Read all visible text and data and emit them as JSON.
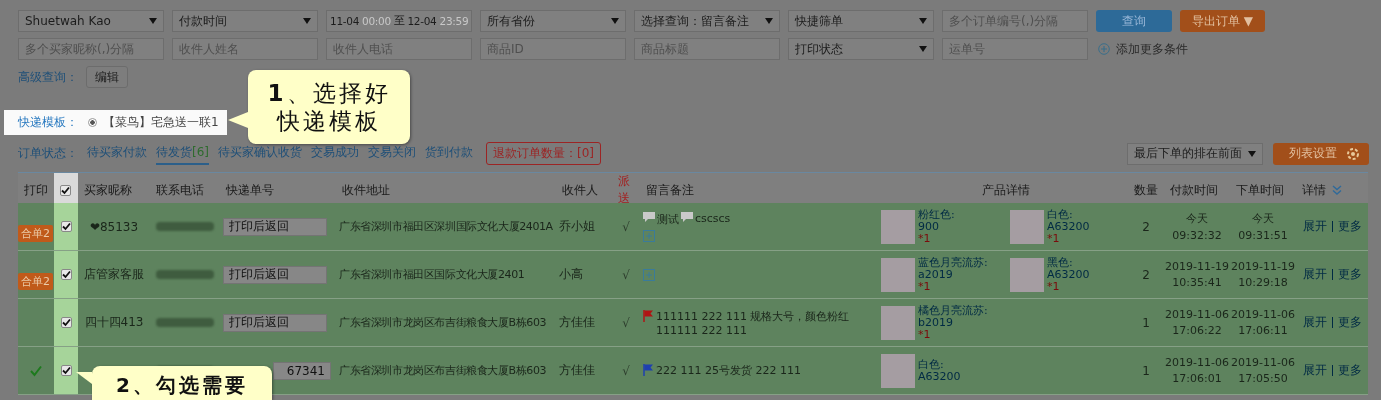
{
  "filters": {
    "rows": [
      [
        {
          "kind": "select",
          "value": "Shuetwah Kao"
        },
        {
          "kind": "select",
          "value": "付款时间"
        },
        {
          "kind": "daterange",
          "parts": [
            {
              "text": "11-04",
              "dim": false
            },
            {
              "text": "00:00",
              "dim": true
            },
            {
              "text": "至",
              "dim": false
            },
            {
              "text": "12-04",
              "dim": false
            },
            {
              "text": "23:59",
              "dim": true
            }
          ]
        },
        {
          "kind": "select",
          "value": "所有省份"
        },
        {
          "kind": "select",
          "value": "选择查询：留言备注"
        },
        {
          "kind": "select",
          "value": "快捷筛单"
        },
        {
          "kind": "input",
          "placeholder": "多个订单编号(,)分隔"
        },
        {
          "kind": "primary",
          "label": "查询"
        },
        {
          "kind": "export",
          "label": "导出订单 ▼"
        }
      ],
      [
        {
          "kind": "input",
          "placeholder": "多个买家昵称(,)分隔"
        },
        {
          "kind": "input",
          "placeholder": "收件人姓名"
        },
        {
          "kind": "input",
          "placeholder": "收件人电话"
        },
        {
          "kind": "input",
          "placeholder": "商品ID"
        },
        {
          "kind": "input",
          "placeholder": "商品标题"
        },
        {
          "kind": "select",
          "value": "打印状态"
        },
        {
          "kind": "input",
          "placeholder": "运单号"
        },
        {
          "kind": "add",
          "label": "添加更多条件"
        }
      ]
    ]
  },
  "advanced": {
    "label": "高级查询：",
    "button": "编辑"
  },
  "template": {
    "label": "快递模板：",
    "options": [
      {
        "label": "【菜鸟】宅急送一联1",
        "selected": true
      }
    ]
  },
  "status_bar": {
    "label": "订单状态：",
    "tabs": [
      {
        "label": "待买家付款",
        "selected": false
      },
      {
        "label": "待发货",
        "count": "[6]",
        "selected": true
      },
      {
        "label": "待买家确认收货",
        "selected": false
      },
      {
        "label": "交易成功",
        "selected": false
      },
      {
        "label": "交易关闭",
        "selected": false
      },
      {
        "label": "货到付款",
        "selected": false
      }
    ],
    "refund": "退款订单数量：[0]",
    "sort": "最后下单的排在前面",
    "settings_button": "列表设置"
  },
  "table": {
    "columns": [
      {
        "kind": "text",
        "label": "打印"
      },
      {
        "kind": "checkbox",
        "checked": true
      },
      {
        "kind": "text",
        "label": "买家昵称"
      },
      {
        "kind": "text",
        "label": "联系电话"
      },
      {
        "kind": "text",
        "label": "快递单号"
      },
      {
        "kind": "text",
        "label": "收件地址"
      },
      {
        "kind": "text",
        "label": "收件人"
      },
      {
        "kind": "accent",
        "label": "派送"
      },
      {
        "kind": "text",
        "label": "留言备注"
      },
      {
        "kind": "text",
        "label": "产品详情"
      },
      {
        "kind": "text",
        "label": "数量"
      },
      {
        "kind": "text",
        "label": "付款时间"
      },
      {
        "kind": "text",
        "label": "下单时间"
      },
      {
        "kind": "expand",
        "label": "详情"
      }
    ],
    "rows": [
      {
        "printed": false,
        "merge_badge": "合单2",
        "checked": true,
        "nickname": "❤85133",
        "tracking": "打印后返回",
        "address": "广东省深圳市福田区深圳国际文化大厦2401A",
        "receiver": "乔小姐",
        "dispatch": "√",
        "notes": [
          {
            "kind": "message",
            "text": "测试"
          },
          {
            "kind": "message",
            "text": "cscscs"
          },
          {
            "kind": "add"
          }
        ],
        "products": [
          {
            "name": "粉红色:",
            "code": "900",
            "qty": "*1"
          },
          {
            "name": "白色:",
            "code": "A63200",
            "qty": "*1"
          }
        ],
        "quantity": "2",
        "paid": [
          "今天",
          "09:32:32"
        ],
        "ordered": [
          "今天",
          "09:31:51"
        ],
        "actions": [
          "展开",
          "更多"
        ]
      },
      {
        "printed": false,
        "merge_badge": "合单2",
        "checked": true,
        "nickname": "店管家客服",
        "tracking": "打印后返回",
        "address": "广东省深圳市福田区国际文化大厦2401",
        "receiver": "小高",
        "dispatch": "√",
        "notes": [
          {
            "kind": "add"
          }
        ],
        "products": [
          {
            "name": "蓝色月亮流苏:",
            "code": "a2019",
            "qty": "*1"
          },
          {
            "name": "黑色:",
            "code": "A63200",
            "qty": "*1"
          }
        ],
        "quantity": "2",
        "paid": [
          "2019-11-19",
          "10:35:41"
        ],
        "ordered": [
          "2019-11-19",
          "10:29:18"
        ],
        "actions": [
          "展开",
          "更多"
        ]
      },
      {
        "printed": false,
        "checked": true,
        "nickname": "四十四413",
        "tracking": "打印后返回",
        "address": "广东省深圳市龙岗区布吉街粮食大厦B栋603",
        "receiver": "方佳佳",
        "dispatch": "√",
        "notes": [
          {
            "kind": "flag",
            "color": "#b01414",
            "text": "111111 222 111 规格大号，颜色粉红 111111 222 111"
          }
        ],
        "products": [
          {
            "name": "橘色月亮流苏:",
            "code": "b2019",
            "qty": "*1"
          }
        ],
        "quantity": "1",
        "paid": [
          "2019-11-06",
          "17:06:22"
        ],
        "ordered": [
          "2019-11-06",
          "17:06:11"
        ],
        "actions": [
          "展开",
          "更多"
        ]
      },
      {
        "printed": true,
        "checked": true,
        "tracking": "67341",
        "address": "广东省深圳市龙岗区布吉街粮食大厦B栋603",
        "receiver": "方佳佳",
        "dispatch": "√",
        "notes": [
          {
            "kind": "flag",
            "color": "#1f3fb0",
            "text": "222 111 25号发货 222 111"
          }
        ],
        "products": [
          {
            "name": "白色:",
            "code": "A63200"
          }
        ],
        "quantity": "1",
        "paid": [
          "2019-11-06",
          "17:06:01"
        ],
        "ordered": [
          "2019-11-06",
          "17:05:50"
        ],
        "actions": [
          "展开",
          "更多"
        ]
      }
    ]
  },
  "callouts": [
    {
      "text": "**1**、选择好快递模板"
    },
    {
      "text": "2、勾选需要"
    }
  ]
}
